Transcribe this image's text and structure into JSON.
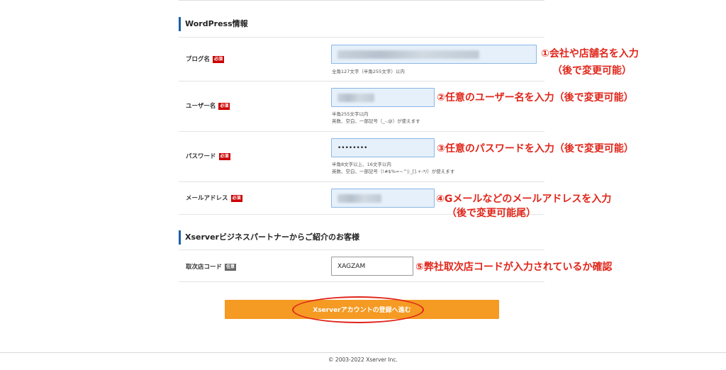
{
  "sections": {
    "wordpress": {
      "title": "WordPress情報"
    },
    "partner": {
      "title": "Xserverビジネスパートナーからご紹介のお客様"
    }
  },
  "badges": {
    "required": "必須",
    "optional": "任意"
  },
  "fields": {
    "blog_name": {
      "label": "ブログ名",
      "hint": "全角127文字（半角255文字）以内"
    },
    "username": {
      "label": "ユーザー名",
      "hint1": "半角255文字以内",
      "hint2": "英数、空白、一部記号（_-.@）が使えます"
    },
    "password": {
      "label": "パスワード",
      "value": "••••••••",
      "hint1": "半角8文字以上、16文字以内",
      "hint2": "英数、空白、一部記号（!#$%=~^|:_[].+-*/）が使えます"
    },
    "email": {
      "label": "メールアドレス"
    },
    "agency_code": {
      "label": "取次店コード",
      "value": "XAGZAM"
    }
  },
  "annotations": {
    "a1_line1": "①会社や店舗名を入力",
    "a1_line2": "（後で変更可能）",
    "a2": "②任意のユーザー名を入力（後で変更可能）",
    "a3": "③任意のパスワードを入力（後で変更可能）",
    "a4_line1": "④Gメールなどのメールアドレスを入力",
    "a4_line2": "（後で変更可能尾）",
    "a5": "⑤弊社取次店コードが入力されているか確認"
  },
  "submit": {
    "label": "Xserverアカウントの登録へ進む"
  },
  "footer": {
    "copyright": "© 2003-2022 Xserver Inc."
  },
  "colors": {
    "accent": "#1e5fa8",
    "required": "#cc0000",
    "button": "#f59a23",
    "annotation": "#e0261b"
  }
}
